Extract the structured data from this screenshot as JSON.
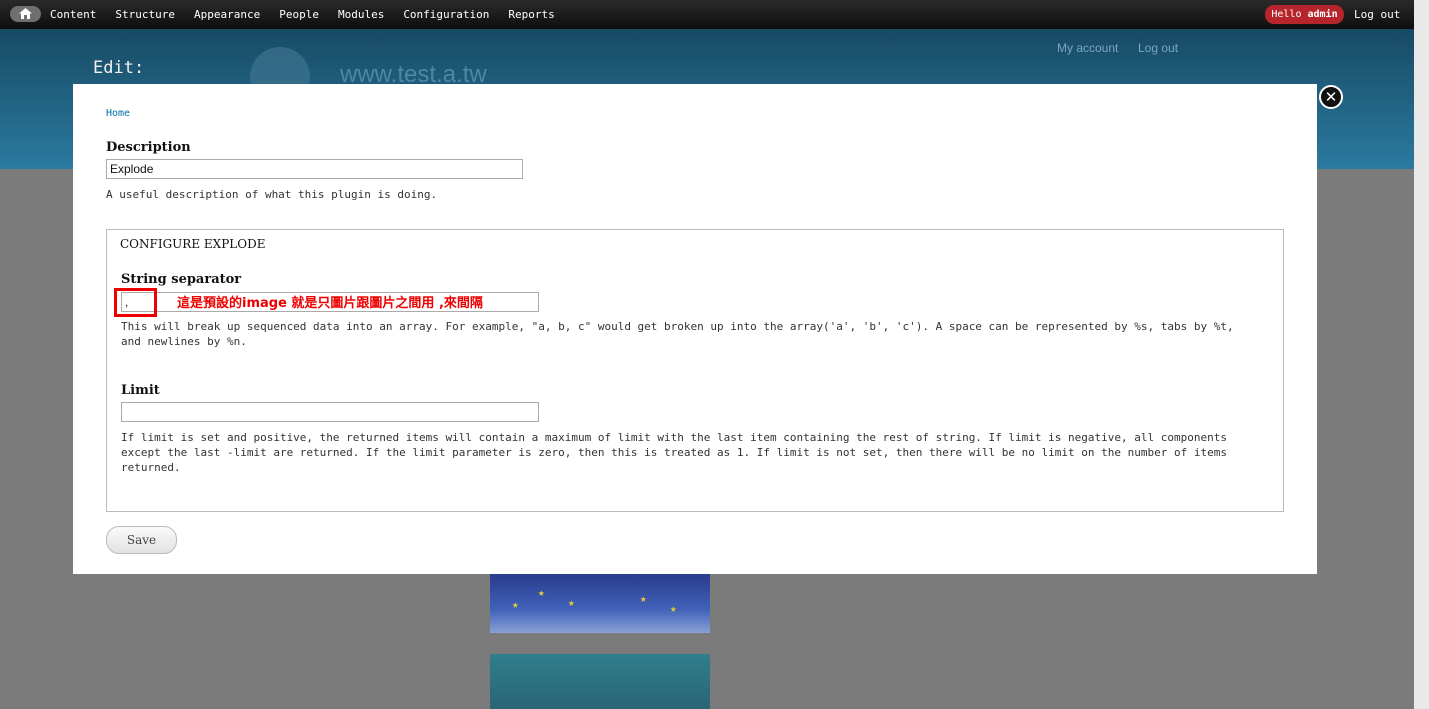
{
  "toolbar": {
    "menu": [
      "Content",
      "Structure",
      "Appearance",
      "People",
      "Modules",
      "Configuration",
      "Reports"
    ],
    "hello_prefix": "Hello ",
    "hello_user": "admin",
    "logout": "Log out"
  },
  "header": {
    "edit_title": "Edit:",
    "site_name": "www.test.a.tw",
    "my_account": "My account",
    "log_out": "Log out"
  },
  "modal": {
    "breadcrumb": "Home",
    "description": {
      "label": "Description",
      "value": "Explode",
      "help": "A useful description of what this plugin is doing."
    },
    "fieldset_legend": "CONFIGURE EXPLODE",
    "separator": {
      "label": "String separator",
      "value": ",",
      "help": "This will break up sequenced data into an array. For example, \"a, b, c\" would get broken up into the array('a', 'b', 'c'). A space can be represented by %s, tabs by %t, and newlines by %n."
    },
    "annotation": "這是預設的image 就是只圖片跟圖片之間用 ,來間隔",
    "limit": {
      "label": "Limit",
      "value": "",
      "help": "If limit is set and positive, the returned items will contain a maximum of limit with the last item containing the rest of string. If limit is negative, all components except the last -limit are returned. If the limit parameter is zero, then this is treated as 1. If limit is not set, then there will be no limit on the number of items returned."
    },
    "save_label": "Save",
    "close_glyph": "✕"
  }
}
